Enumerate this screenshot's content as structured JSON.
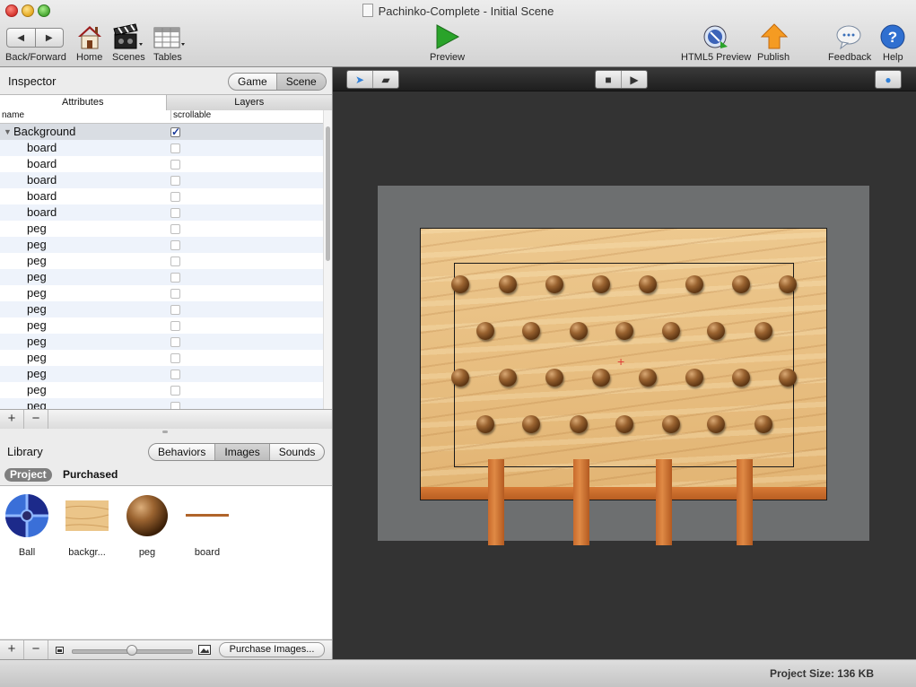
{
  "window": {
    "title": "Pachinko-Complete - Initial Scene"
  },
  "toolbar": {
    "back_forward": "Back/Forward",
    "home": "Home",
    "scenes": "Scenes",
    "tables": "Tables",
    "preview": "Preview",
    "html5_preview": "HTML5 Preview",
    "publish": "Publish",
    "feedback": "Feedback",
    "help": "Help"
  },
  "inspector": {
    "title": "Inspector",
    "mode_game": "Game",
    "mode_scene": "Scene",
    "tab_attributes": "Attributes",
    "tab_layers": "Layers",
    "col_name": "name",
    "col_scrollable": "scrollable",
    "group": {
      "name": "Background",
      "scrollable": true
    },
    "rows": [
      {
        "name": "board"
      },
      {
        "name": "board"
      },
      {
        "name": "board"
      },
      {
        "name": "board"
      },
      {
        "name": "board"
      },
      {
        "name": "peg"
      },
      {
        "name": "peg"
      },
      {
        "name": "peg"
      },
      {
        "name": "peg"
      },
      {
        "name": "peg"
      },
      {
        "name": "peg"
      },
      {
        "name": "peg"
      },
      {
        "name": "peg"
      },
      {
        "name": "peg"
      },
      {
        "name": "peg"
      },
      {
        "name": "peg"
      },
      {
        "name": "peg"
      }
    ]
  },
  "library": {
    "title": "Library",
    "tab_behaviors": "Behaviors",
    "tab_images": "Images",
    "tab_sounds": "Sounds",
    "sub_project": "Project",
    "sub_purchased": "Purchased",
    "assets": [
      {
        "label": "Ball",
        "icon": "ball-icon"
      },
      {
        "label": "backgr...",
        "icon": "wood-texture"
      },
      {
        "label": "peg",
        "icon": "peg-icon"
      },
      {
        "label": "board",
        "icon": "board-line"
      }
    ],
    "purchase_button": "Purchase Images..."
  },
  "status": {
    "project_size": "Project Size: 136 KB"
  },
  "colors": {
    "canvas": "#333333",
    "stage": "#6d6f70",
    "wood": "#e8be82",
    "post": "#c86a2c",
    "accent": "#2f7fd8"
  }
}
